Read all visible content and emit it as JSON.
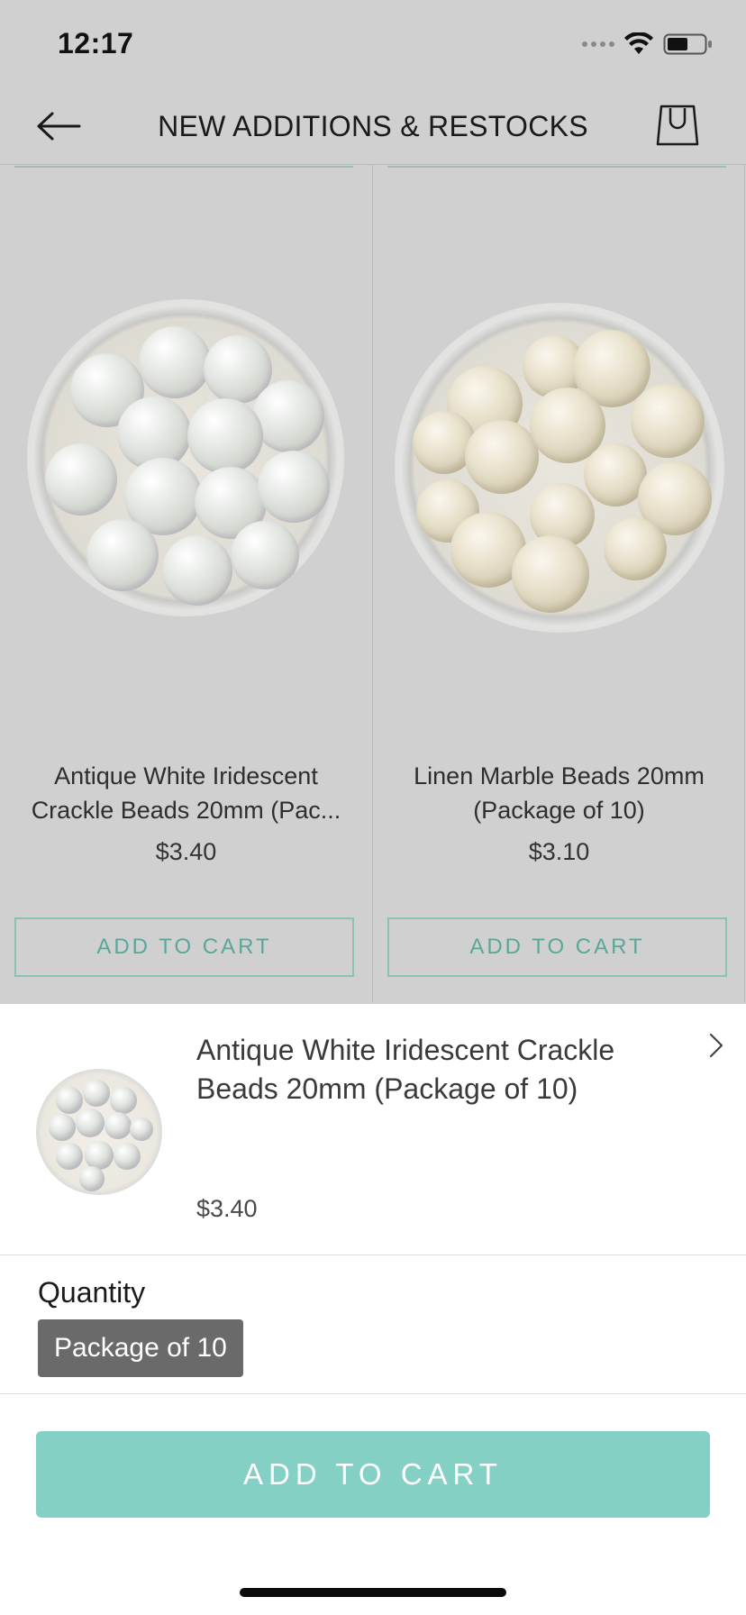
{
  "status_bar": {
    "time": "12:17",
    "icons": [
      "cellular-signal-icon",
      "wifi-icon",
      "battery-icon"
    ]
  },
  "header": {
    "title": "NEW ADDITIONS & RESTOCKS",
    "back_icon": "back-arrow-icon",
    "cart_icon": "shopping-bag-icon"
  },
  "products": [
    {
      "title_line1": "Antique White Iridescent",
      "title_line2": "Crackle Beads 20mm (Pac...",
      "price": "$3.40",
      "button_label": "ADD TO CART"
    },
    {
      "title_line1": "Linen Marble Beads 20mm",
      "title_line2": "(Package of 10)",
      "price": "$3.10",
      "button_label": "ADD TO CART"
    }
  ],
  "sheet": {
    "product_title": "Antique White Iridescent Crackle Beads 20mm (Package of 10)",
    "price": "$3.40",
    "quantity_label": "Quantity",
    "quantity_option": "Package of 10",
    "add_to_cart_label": "ADD TO CART"
  },
  "colors": {
    "accent": "#84d0c4",
    "accent_outline": "#8ac2b8",
    "overlay": "#d0d0d0",
    "chip": "#6a6a6a"
  }
}
